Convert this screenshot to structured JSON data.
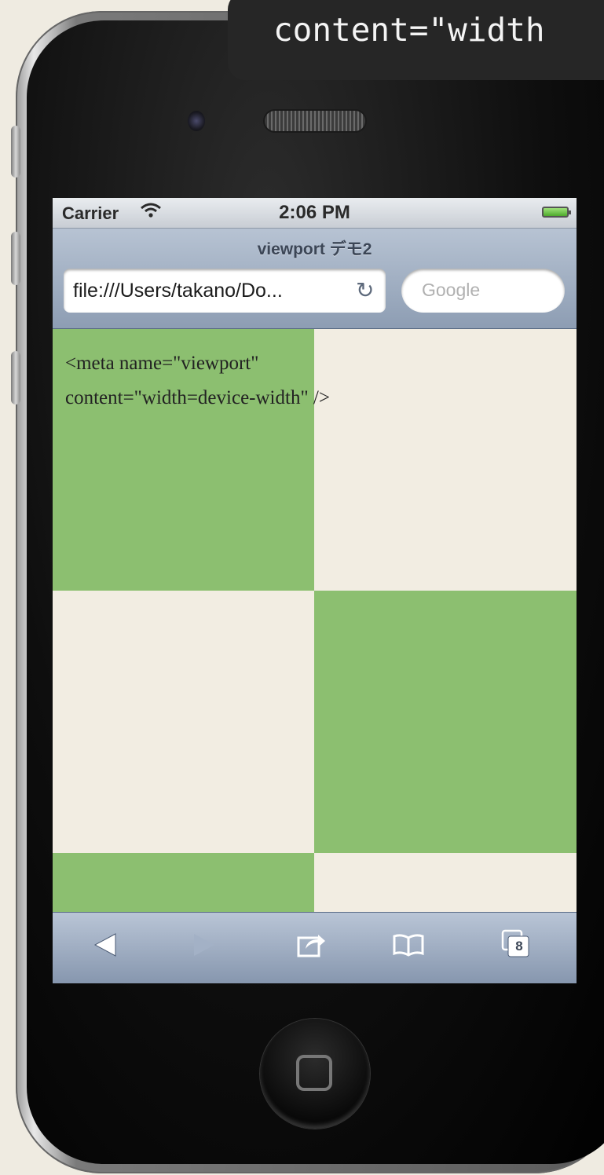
{
  "callout": {
    "code_text": "content=\"width"
  },
  "status_bar": {
    "carrier": "Carrier",
    "time": "2:06 PM"
  },
  "browser": {
    "page_title": "viewport デモ2",
    "url": "file:///Users/takano/Do...",
    "search_placeholder": "Google"
  },
  "page": {
    "line1": "<meta name=\"viewport\"",
    "line2": "content=\"width=device-width\" />",
    "colors": {
      "green": "#8cbf70",
      "cream": "#f2ede2"
    }
  },
  "toolbar": {
    "icons": [
      "back-arrow-icon",
      "forward-arrow-icon",
      "share-icon",
      "bookmarks-icon",
      "tabs-icon"
    ],
    "tab_count": "8"
  }
}
